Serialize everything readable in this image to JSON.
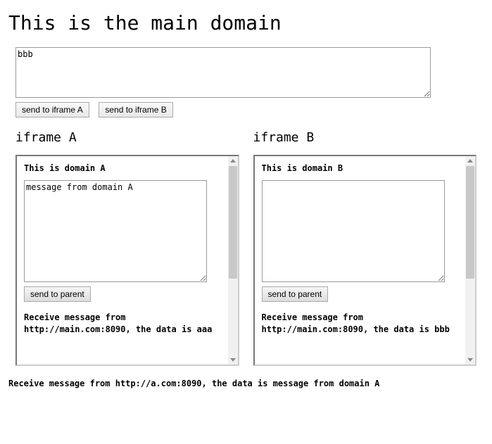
{
  "main": {
    "heading": "This is the main domain",
    "textarea_value": "bbb",
    "send_a_label": "send to iframe A",
    "send_b_label": "send to iframe B"
  },
  "iframes": {
    "a": {
      "label": "iframe A",
      "title": "This is domain A",
      "textarea_value": "message from domain A",
      "send_parent_label": "send to parent",
      "receive_msg": "Receive message from http://main.com:8090, the data is aaa"
    },
    "b": {
      "label": "iframe B",
      "title": "This is domain B",
      "textarea_value": "",
      "send_parent_label": "send to parent",
      "receive_msg": "Receive message from http://main.com:8090, the data is bbb"
    }
  },
  "footer_msg": "Receive message from http://a.com:8090, the data is message from domain A"
}
